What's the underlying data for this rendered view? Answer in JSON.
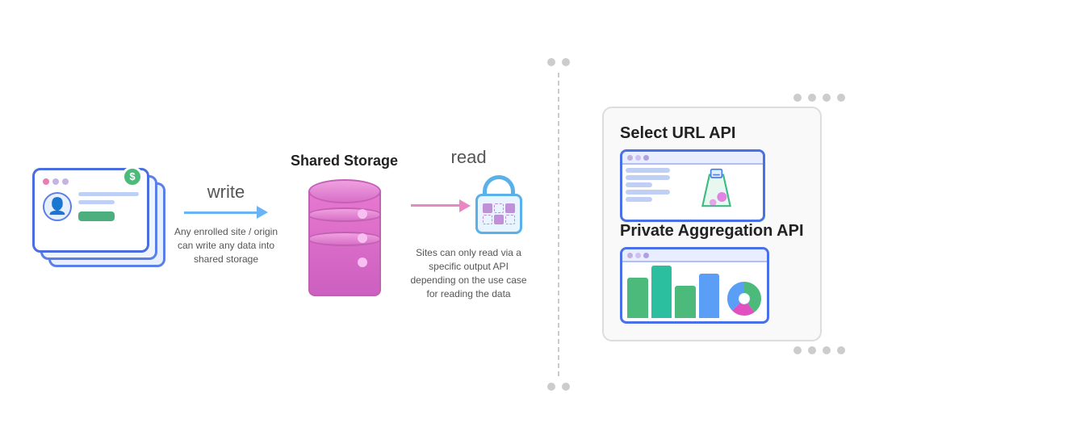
{
  "diagram": {
    "write_label": "write",
    "read_label": "read",
    "storage_title": "Shared Storage",
    "write_desc": "Any enrolled site / origin can write any data into shared storage",
    "read_desc": "Sites can only read via a specific output API depending on the use case for reading the data",
    "select_url_api_title": "Select URL API",
    "private_aggregation_api_title": "Private Aggregation API"
  },
  "colors": {
    "blue_arrow": "#6ab4f5",
    "pink_arrow": "#e887c3",
    "db_color": "#d870c8",
    "lock_color": "#5ab0e8",
    "card_border": "#4a6ee0",
    "bar1": "#4cba7a",
    "bar2": "#2bbfa0",
    "bar3": "#5b9ef5"
  }
}
